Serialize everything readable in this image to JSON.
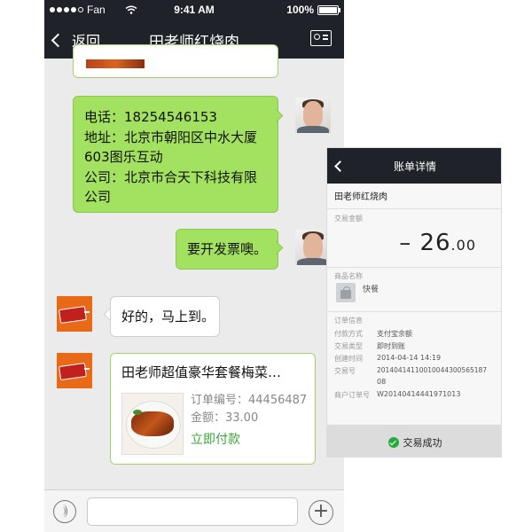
{
  "status_bar": {
    "carrier": "Fan",
    "time": "9:41 AM",
    "battery": "100%"
  },
  "nav": {
    "back_label": "返回",
    "title": "田老师红烧肉"
  },
  "messages": {
    "contact_info": {
      "phone": "电话：18254546153",
      "address_line1": "地址：北京市朝阳区中水大厦",
      "address_line2": "603图乐互动",
      "company_line1": "公司：北京市合天下科技有限",
      "company_line2": "公司"
    },
    "invoice_request": "要开发票噢。",
    "reply": "好的，马上到。",
    "order_card": {
      "title": "田老师超值豪华套餐梅菜…",
      "order_no": "订单编号：44456487",
      "amount": "金额：33.00",
      "pay_now": "立即付款"
    }
  },
  "bill": {
    "title": "账单详情",
    "merchant": "田老师红烧肉",
    "amount_label": "交易金额",
    "amount_int": "– 26",
    "amount_dec": ".00",
    "product_label": "商品名称",
    "product_name": "快餐",
    "order_info_label": "订单信息",
    "rows": [
      {
        "label": "付款方式",
        "value": "支付宝余额"
      },
      {
        "label": "交易类型",
        "value": "即时到账"
      },
      {
        "label": "创建时间",
        "value": "2014-04-14 14:19"
      },
      {
        "label": "交易号",
        "value": "20140414110010044300565187"
      },
      {
        "label": "",
        "value": "08"
      },
      {
        "label": "商户订单号",
        "value": "W20140414441971013"
      }
    ],
    "success": "交易成功"
  },
  "colors": {
    "nav_bg": "#1f2229",
    "chat_bg": "#ebebeb",
    "green_bubble": "#a3e260",
    "pay_green": "#3aa43a",
    "success_check": "#22ac38"
  }
}
